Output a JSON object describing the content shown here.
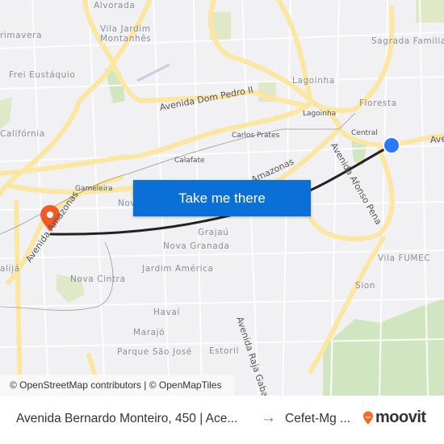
{
  "map": {
    "labels": {
      "alvorada": "Alvorada",
      "vila_jardim": "Vila Jardim",
      "montanhes": "Montanhês",
      "primavera": "rimavera",
      "frei_eustaquio": "Frei Eustáquio",
      "california": "Califórnia",
      "calafate": "Calafate",
      "gameleira": "Gameleira",
      "nova_suica_partial": "Nov",
      "lagoinha_district": "Lagoinha",
      "lagoinha": "Lagoinha",
      "floresta": "Floresta",
      "sagrada_familia": "Sagrada Família",
      "carlos_prates": "Carlos Prates",
      "central": "Central",
      "grajau": "Grajaú",
      "nova_granada": "Nova Granada",
      "jardim_america": "Jardim América",
      "nova_cintra": "Nova Cintra",
      "havai": "Havaí",
      "marajo": "Marajó",
      "parque_sao_jose": "Parque São José",
      "estoril": "Estoril",
      "vila_fumec": "Vila FUMEC",
      "sion": "Sion",
      "alija": "alijá"
    },
    "roads": {
      "dom_pedro": "Avenida Dom Pedro II",
      "afonso_pena": "Avenida Afonso Pena",
      "amazonas": "Avenida Amazonas",
      "raja_gabaglia": "Avenida Raja Gabaglia",
      "amazonas_east": "Amazonas",
      "ave_partial": "Ave"
    },
    "attribution": "© OpenStreetMap contributors | © OpenMapTiles",
    "colors": {
      "route": "#222222",
      "origin": "#2979ff",
      "destination": "#f15a24",
      "button": "#0a6fd6"
    }
  },
  "cta": {
    "label": "Take me there"
  },
  "footer": {
    "from": "Avenida Bernardo Monteiro, 450 | Ace...",
    "arrow": "→",
    "to": "Cefet-Mg ...",
    "logo": "moovit"
  }
}
